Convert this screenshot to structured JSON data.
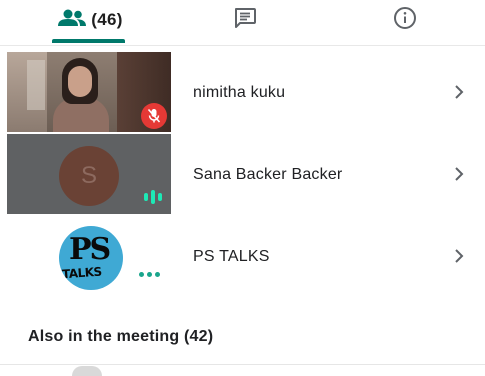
{
  "tabs": {
    "people": {
      "icon": "people-icon",
      "count_label": "(46)",
      "active": true
    },
    "chat": {
      "icon": "chat-icon"
    },
    "info": {
      "icon": "info-icon"
    }
  },
  "participants": [
    {
      "name": "nimitha kuku",
      "tile": "video",
      "status_icon": "mic-off-icon"
    },
    {
      "name": "Sana Backer Backer",
      "tile": "avatar",
      "avatar_letter": "S",
      "status_icon": "speaking-bars-icon"
    },
    {
      "name": "PS TALKS",
      "tile": "logo",
      "logo_text_top": "PS",
      "logo_text_bottom": "TALKS",
      "status_icon": "more-dots-icon"
    }
  ],
  "section": {
    "heading": "Also in the meeting (42)"
  },
  "colors": {
    "accent": "#00796b",
    "mic_off": "#e53935",
    "speaking": "#1de9b6",
    "avatar_bg": "#6a4235",
    "tile_grey": "#5f6163",
    "logo_blue": "#3fa9d4"
  }
}
